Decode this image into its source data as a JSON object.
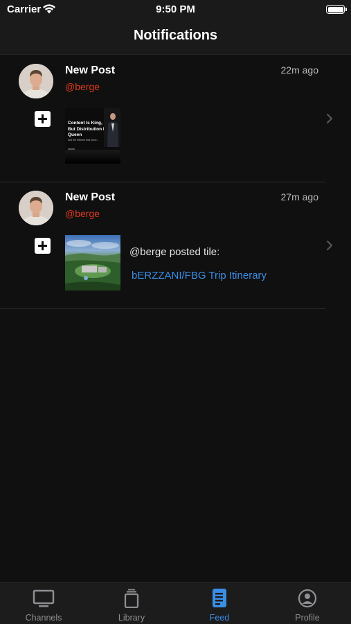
{
  "status_bar": {
    "carrier": "Carrier",
    "time": "9:50 PM"
  },
  "nav": {
    "title": "Notifications"
  },
  "notifications": [
    {
      "title": "New Post",
      "handle": "@berge",
      "time": "22m ago",
      "thumbnail": {
        "headline": "Content Is King, But Distribution Is Queen",
        "subline": "And the winners that prove..."
      }
    },
    {
      "title": "New Post",
      "handle": "@berge",
      "time": "27m ago",
      "post_text": "@berge posted tile:",
      "post_link": "bERZZANI/FBG Trip Itinerary"
    }
  ],
  "tab_bar": {
    "active": "Feed",
    "tabs": [
      {
        "label": "Channels",
        "icon": "tv-icon"
      },
      {
        "label": "Library",
        "icon": "library-icon"
      },
      {
        "label": "Feed",
        "icon": "document-icon"
      },
      {
        "label": "Profile",
        "icon": "user-circle-icon"
      }
    ]
  },
  "colors": {
    "accent": "#3a8ee6",
    "handle": "#e03a1f",
    "background": "#101010"
  }
}
